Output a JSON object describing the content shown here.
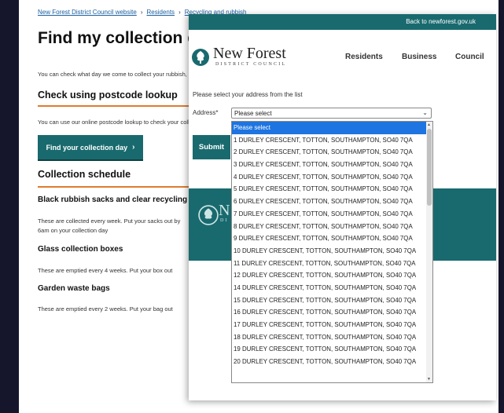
{
  "background_page": {
    "breadcrumb": [
      "New Forest District Council website",
      "Residents",
      "Recycling and rubbish"
    ],
    "title": "Find my collection day",
    "intro": "You can check what day we come to collect your rubbish, recycling, glass and garden waste.",
    "postcode_heading": "Check using postcode lookup",
    "postcode_text": "You can use our online postcode lookup to check your collection day.",
    "find_button": "Find your collection day",
    "schedule_heading": "Collection schedule",
    "black_heading": "Black rubbish sacks and clear recycling sacks",
    "black_text_1": "These are collected every week. Put your sacks out by",
    "black_text_2": "6am on your collection day",
    "glass_heading": "Glass collection boxes",
    "glass_text": "These are emptied every 4 weeks. Put your box out",
    "garden_heading": "Garden waste bags",
    "garden_text": "These are emptied every 2 weeks. Put your bag out"
  },
  "popup": {
    "back_link": "Back to newforest.gov.uk",
    "logo_name": "New Forest",
    "logo_sub": "DISTRICT COUNCIL",
    "nav": [
      "Residents",
      "Business",
      "Council"
    ],
    "prompt": "Please select your address from the list",
    "address_label": "Address*",
    "select_value": "Please select",
    "submit": "Submit",
    "band_letter": "N",
    "band_sub": "DI"
  },
  "dropdown": {
    "options": [
      "Please select",
      "1 DURLEY CRESCENT, TOTTON, SOUTHAMPTON, SO40 7QA",
      "2 DURLEY CRESCENT, TOTTON, SOUTHAMPTON, SO40 7QA",
      "3 DURLEY CRESCENT, TOTTON, SOUTHAMPTON, SO40 7QA",
      "4 DURLEY CRESCENT, TOTTON, SOUTHAMPTON, SO40 7QA",
      "5 DURLEY CRESCENT, TOTTON, SOUTHAMPTON, SO40 7QA",
      "6 DURLEY CRESCENT, TOTTON, SOUTHAMPTON, SO40 7QA",
      "7 DURLEY CRESCENT, TOTTON, SOUTHAMPTON, SO40 7QA",
      "8 DURLEY CRESCENT, TOTTON, SOUTHAMPTON, SO40 7QA",
      "9 DURLEY CRESCENT, TOTTON, SOUTHAMPTON, SO40 7QA",
      "10 DURLEY CRESCENT, TOTTON, SOUTHAMPTON, SO40 7QA",
      "11 DURLEY CRESCENT, TOTTON, SOUTHAMPTON, SO40 7QA",
      "12 DURLEY CRESCENT, TOTTON, SOUTHAMPTON, SO40 7QA",
      "14 DURLEY CRESCENT, TOTTON, SOUTHAMPTON, SO40 7QA",
      "15 DURLEY CRESCENT, TOTTON, SOUTHAMPTON, SO40 7QA",
      "16 DURLEY CRESCENT, TOTTON, SOUTHAMPTON, SO40 7QA",
      "17 DURLEY CRESCENT, TOTTON, SOUTHAMPTON, SO40 7QA",
      "18 DURLEY CRESCENT, TOTTON, SOUTHAMPTON, SO40 7QA",
      "19 DURLEY CRESCENT, TOTTON, SOUTHAMPTON, SO40 7QA",
      "20 DURLEY CRESCENT, TOTTON, SOUTHAMPTON, SO40 7QA"
    ],
    "selected_index": 0
  },
  "icons": {
    "breadcrumb_separator": "chevron-right-icon",
    "find_button_icon": "chevron-right-icon",
    "select_arrow": "chevron-down-icon",
    "logo": "tree-emblem-icon"
  },
  "colors": {
    "teal": "#196a6e",
    "accent_orange": "#e07b2e",
    "link_blue": "#1a5fa0",
    "selection_blue": "#1e74e0",
    "backdrop": "#15152b"
  }
}
